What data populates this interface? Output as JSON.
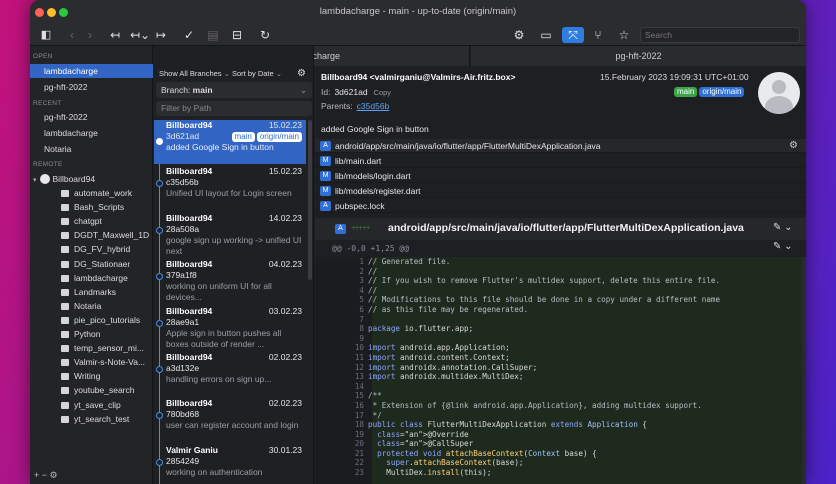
{
  "window": {
    "title": "lambdacharge - main - up-to-date (origin/main)"
  },
  "toolbar": {
    "search_placeholder": "Search",
    "icons": [
      "sidebar-icon",
      "back-icon",
      "forward-icon",
      "undo-icon",
      "undo-menu-icon",
      "redo-icon",
      "commit-icon",
      "stash-icon",
      "archive-icon",
      "refresh-icon",
      "settings-icon",
      "layout-icon",
      "graph-icon",
      "branch-icon",
      "star-icon"
    ]
  },
  "tabs": [
    {
      "label": "lambdacharge"
    },
    {
      "label": "pg-hft-2022"
    }
  ],
  "sidebar": {
    "open_heading": "OPEN",
    "open_items": [
      "lambdacharge",
      "pg-hft-2022"
    ],
    "recent_heading": "RECENT",
    "recent_items": [
      "pg-hft-2022",
      "lambdacharge",
      "Notaria"
    ],
    "remote_heading": "REMOTE",
    "remote_account": "Billboard94",
    "remote_items": [
      "automate_work",
      "Bash_Scripts",
      "chatgpt",
      "DGDT_Maxwell_1D",
      "DG_FV_hybrid",
      "DG_Stationaer",
      "lambdacharge",
      "Landmarks",
      "Notaria",
      "pie_pico_tutorials",
      "Python",
      "temp_sensor_mi...",
      "Valmir-s-Note-Va...",
      "Writing",
      "youtube_search",
      "yt_save_clip",
      "yt_search_test"
    ],
    "bottom_controls": "+ − ⚙"
  },
  "commit_list": {
    "show_branches": "Show All Branches",
    "sort_by": "Sort by Date",
    "branch_label": "Branch:",
    "branch_value": "main",
    "filter_placeholder": "Filter by Path",
    "commits": [
      {
        "author": "Billboard94",
        "date": "15.02.23",
        "hash": "3d621ad",
        "message": "added Google Sign in button",
        "badges": [
          "main",
          "origin/main"
        ]
      },
      {
        "author": "Billboard94",
        "date": "15.02.23",
        "hash": "c35d56b",
        "message": "Unified UI layout for Login screen"
      },
      {
        "author": "Billboard94",
        "date": "14.02.23",
        "hash": "28a508a",
        "message": "google sign up working -> unified UI next"
      },
      {
        "author": "Billboard94",
        "date": "04.02.23",
        "hash": "379a1f8",
        "message": "working on uniform UI for all devices..."
      },
      {
        "author": "Billboard94",
        "date": "03.02.23",
        "hash": "28ae9a1",
        "message": "Apple sign in button pushes all boxes outside of render ..."
      },
      {
        "author": "Billboard94",
        "date": "02.02.23",
        "hash": "a3d132e",
        "message": "handling errors on sign up..."
      },
      {
        "author": "Billboard94",
        "date": "02.02.23",
        "hash": "780bd68",
        "message": "user can register account and login"
      },
      {
        "author": "Valmir Ganiu",
        "date": "30.01.23",
        "hash": "2854249",
        "message": "working on authentication"
      }
    ]
  },
  "detail": {
    "author": "Billboard94 <valmirganiu@Valmirs-Air.fritz.box>",
    "date": "15.February 2023 19:09:31 UTC+01:00",
    "id_label": "Id:",
    "id_value": "3d621ad",
    "copy_label": "Copy",
    "parents_label": "Parents:",
    "parents_value": "c35d56b",
    "badges": [
      "main",
      "origin/main"
    ],
    "message": "added Google Sign in button",
    "files": [
      {
        "badge": "A",
        "path": "android/app/src/main/java/io/flutter/app/FlutterMultiDexApplication.java"
      },
      {
        "badge": "M",
        "path": "lib/main.dart"
      },
      {
        "badge": "M",
        "path": "lib/models/login.dart"
      },
      {
        "badge": "M",
        "path": "lib/models/register.dart"
      },
      {
        "badge": "A",
        "path": "pubspec.lock"
      }
    ],
    "diff_file": "android/app/src/main/java/io/flutter/app/FlutterMultiDexApplication.java",
    "diff_badge": "A",
    "hunk_header": "@@ -0,0 +1,25 @@",
    "code": [
      {
        "n": "1",
        "t": "// Generated file."
      },
      {
        "n": "2",
        "t": "//"
      },
      {
        "n": "3",
        "t": "// If you wish to remove Flutter's multidex support, delete this entire file."
      },
      {
        "n": "4",
        "t": "//"
      },
      {
        "n": "5",
        "t": "// Modifications to this file should be done in a copy under a different name"
      },
      {
        "n": "6",
        "t": "// as this file may be regenerated."
      },
      {
        "n": "7",
        "t": ""
      },
      {
        "n": "8",
        "t": "package io.flutter.app;"
      },
      {
        "n": "9",
        "t": ""
      },
      {
        "n": "10",
        "t": "import android.app.Application;"
      },
      {
        "n": "11",
        "t": "import android.content.Context;"
      },
      {
        "n": "12",
        "t": "import androidx.annotation.CallSuper;"
      },
      {
        "n": "13",
        "t": "import androidx.multidex.MultiDex;"
      },
      {
        "n": "14",
        "t": ""
      },
      {
        "n": "15",
        "t": "/**"
      },
      {
        "n": "16",
        "t": " * Extension of {@link android.app.Application}, adding multidex support."
      },
      {
        "n": "17",
        "t": " */"
      },
      {
        "n": "18",
        "t": "public class FlutterMultiDexApplication extends Application {"
      },
      {
        "n": "19",
        "t": "  @Override"
      },
      {
        "n": "20",
        "t": "  @CallSuper"
      },
      {
        "n": "21",
        "t": "  protected void attachBaseContext(Context base) {"
      },
      {
        "n": "22",
        "t": "    super.attachBaseContext(base);"
      },
      {
        "n": "23",
        "t": "    MultiDex.install(this);"
      }
    ]
  }
}
